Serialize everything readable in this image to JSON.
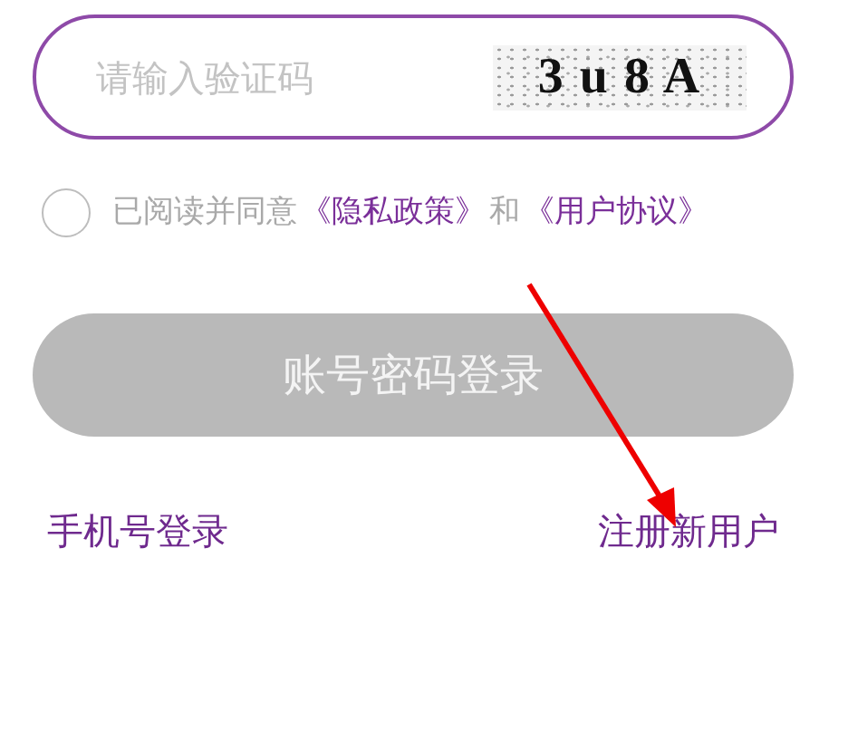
{
  "captcha_field": {
    "placeholder": "请输入验证码",
    "captcha": "3 u 8 A"
  },
  "agreement": {
    "checked": false,
    "parts": [
      {
        "kind": "text",
        "text": "已阅读并同意"
      },
      {
        "kind": "link",
        "text": "《隐私政策》"
      },
      {
        "kind": "text",
        "text": "和"
      },
      {
        "kind": "link",
        "text": "《用户协议》"
      }
    ]
  },
  "login_button": {
    "label": "账号密码登录",
    "disabled": true
  },
  "links": [
    {
      "text": "手机号登录"
    },
    {
      "text": "注册新用户"
    }
  ],
  "annotation": {
    "kind": "arrow"
  }
}
